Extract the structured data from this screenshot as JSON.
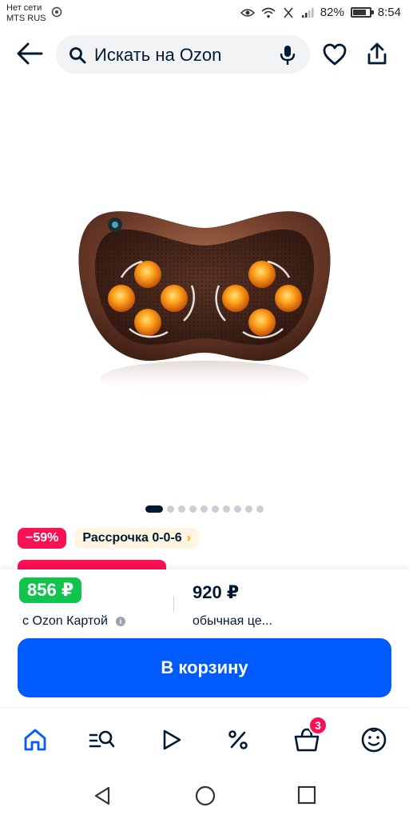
{
  "status_bar": {
    "carrier_line1": "Нет сети",
    "carrier_line2": "MTS RUS",
    "battery": "82%",
    "battery_level": 0.82,
    "time": "8:54"
  },
  "header": {
    "search_placeholder": "Искать на Ozon",
    "icons": [
      "back-arrow-icon",
      "search-icon",
      "microphone-icon",
      "heart-icon",
      "share-icon"
    ]
  },
  "gallery": {
    "image_alt": "massage-pillow",
    "total_images": 10,
    "active_index": 0
  },
  "badges": {
    "discount": "−59%",
    "installment": "Рассрочка 0-0-6",
    "installment_chevron": "›"
  },
  "price": {
    "ozon_price": "856 ₽",
    "ozon_label": "с Ozon Картой",
    "info_icon": "i",
    "regular_price": "920 ₽",
    "regular_label": "обычная це..."
  },
  "actions": {
    "add_to_cart": "В корзину"
  },
  "bottom_nav": {
    "items": [
      "home-icon",
      "catalog-search-icon",
      "video-play-icon",
      "percent-icon",
      "cart-icon",
      "profile-icon"
    ],
    "cart_count": "3",
    "active": "home-icon"
  },
  "colors": {
    "brand_blue": "#005bff",
    "discount_pink": "#f91155",
    "ozon_green": "#10c44c",
    "text_dark": "#001a34"
  }
}
